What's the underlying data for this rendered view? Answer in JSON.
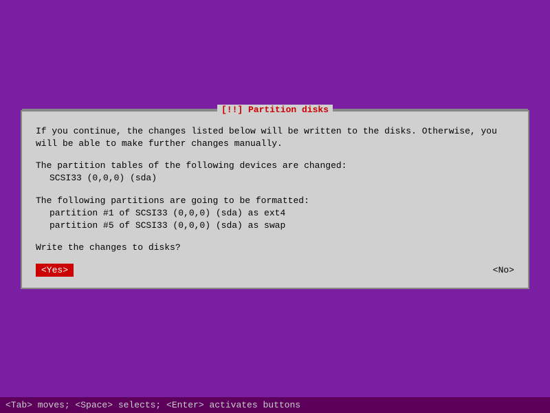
{
  "title": "[!!] Partition disks",
  "dialog": {
    "body_line1": "If you continue, the changes listed below will be written to the disks. Otherwise, you",
    "body_line2": "will be able to make further changes manually.",
    "section1_heading": "The partition tables of the following devices are changed:",
    "section1_item1": "SCSI33 (0,0,0) (sda)",
    "section2_heading": "The following partitions are going to be formatted:",
    "section2_item1": "partition #1 of SCSI33 (0,0,0) (sda) as ext4",
    "section2_item2": "partition #5 of SCSI33 (0,0,0) (sda) as swap",
    "question": "Write the changes to disks?",
    "yes_button": "<Yes>",
    "no_button": "<No>"
  },
  "status_bar": "<Tab> moves; <Space> selects; <Enter> activates buttons"
}
